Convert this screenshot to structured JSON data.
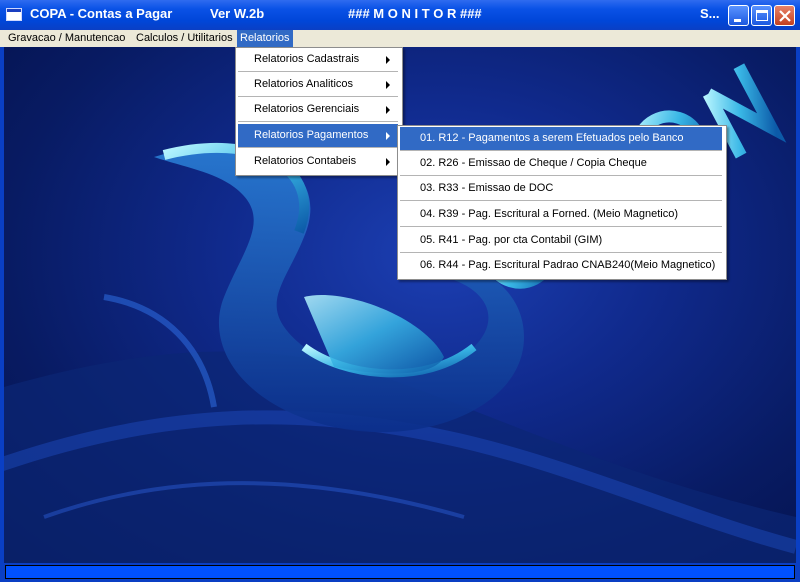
{
  "window": {
    "app_title": "COPA - Contas a Pagar",
    "version": "Ver W.2b",
    "monitor": "###  M O N I T O R  ###",
    "truncated": "S..."
  },
  "menubar": {
    "items": [
      {
        "label": "Gravacao / Manutencao"
      },
      {
        "label": "Calculos / Utilitarios"
      },
      {
        "label": "Relatorios"
      }
    ]
  },
  "relatorios_menu": {
    "items": [
      {
        "label": "Relatorios Cadastrais"
      },
      {
        "label": "Relatorios Analiticos"
      },
      {
        "label": "Relatorios Gerenciais"
      },
      {
        "label": "Relatorios Pagamentos"
      },
      {
        "label": "Relatorios Contabeis"
      }
    ]
  },
  "pagamentos_submenu": {
    "items": [
      {
        "label": "01. R12 - Pagamentos a serem Efetuados pelo Banco"
      },
      {
        "label": "02. R26 - Emissao de Cheque / Copia Cheque"
      },
      {
        "label": "03. R33 - Emissao de DOC"
      },
      {
        "label": "04. R39 - Pag. Escritural a Forned. (Meio Magnetico)"
      },
      {
        "label": "05. R41 - Pag. por cta Contabil (GIM)"
      },
      {
        "label": "06. R44 - Pag. Escritural Padrao CNAB240(Meio Magnetico)"
      }
    ]
  },
  "colors": {
    "highlight": "#316ac5",
    "titlebar": "#0a52e6",
    "background": "#0b1e6b"
  },
  "icons": [
    "app-icon",
    "minimize-icon",
    "maximize-icon",
    "close-icon",
    "submenu-arrow-icon"
  ]
}
